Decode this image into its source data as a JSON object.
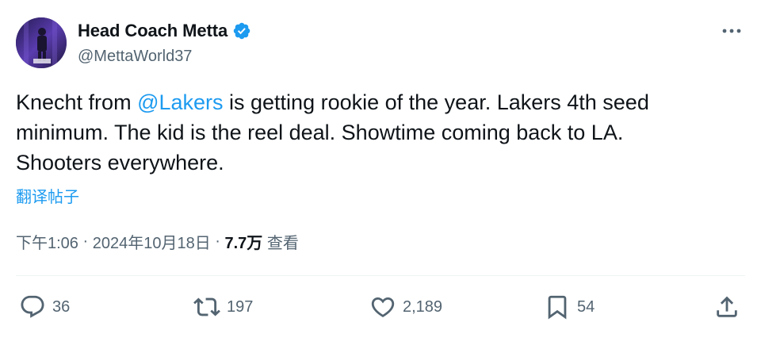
{
  "author": {
    "display_name": "Head Coach Metta",
    "handle": "@MettaWorld37",
    "verified": true,
    "avatar_icon": "profile-photo"
  },
  "post": {
    "text_before": "Knecht from ",
    "mention": "@Lakers",
    "text_after": " is getting rookie of the year. Lakers 4th seed minimum.  The kid is the reel deal. Showtime coming back to LA. Shooters everywhere.",
    "translate_label": "翻译帖子",
    "time": "下午1:06",
    "date": "2024年10月18日",
    "separator": " · ",
    "views_count": "7.7万",
    "views_label": "查看"
  },
  "actions": {
    "replies": "36",
    "reposts": "197",
    "likes": "2,189",
    "bookmarks": "54"
  },
  "colors": {
    "accent": "#1d9bf0",
    "secondary_text": "#536471",
    "primary_text": "#0f1419",
    "divider": "#eff3f4"
  }
}
